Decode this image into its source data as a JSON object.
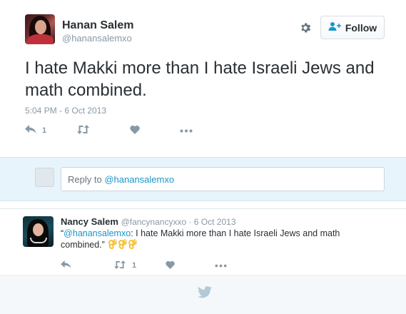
{
  "tweet": {
    "author_name": "Hanan Salem",
    "author_handle": "@hanansalemxo",
    "follow_label": "Follow",
    "text": "I hate Makki more than I hate Israeli Jews and math combined.",
    "timestamp": "5:04 PM - 6 Oct 2013",
    "reply_count": "1",
    "retweet_count": "",
    "like_count": ""
  },
  "reply_box": {
    "prefix": "Reply to ",
    "mention": "@hanansalemxo"
  },
  "reply": {
    "author_name": "Nancy Salem",
    "author_handle": "@fancynancyxxo",
    "separator": " · ",
    "date": "6 Oct 2013",
    "open_quote": "“",
    "mention": "@hanansalemxo",
    "text_rest": ": I hate Makki more than I hate Israeli Jews and math combined.”",
    "emoji": [
      "ok-hand-icon",
      "ok-hand-icon",
      "ok-hand-icon"
    ],
    "reply_count": "",
    "retweet_count": "1",
    "like_count": ""
  },
  "colors": {
    "text": "#292f33",
    "muted": "#8899a6",
    "link": "#1b95c8",
    "reply_bg": "#e8f4fb",
    "footer_bg": "#f5f8fa",
    "twitter_blue": "#55acee"
  }
}
